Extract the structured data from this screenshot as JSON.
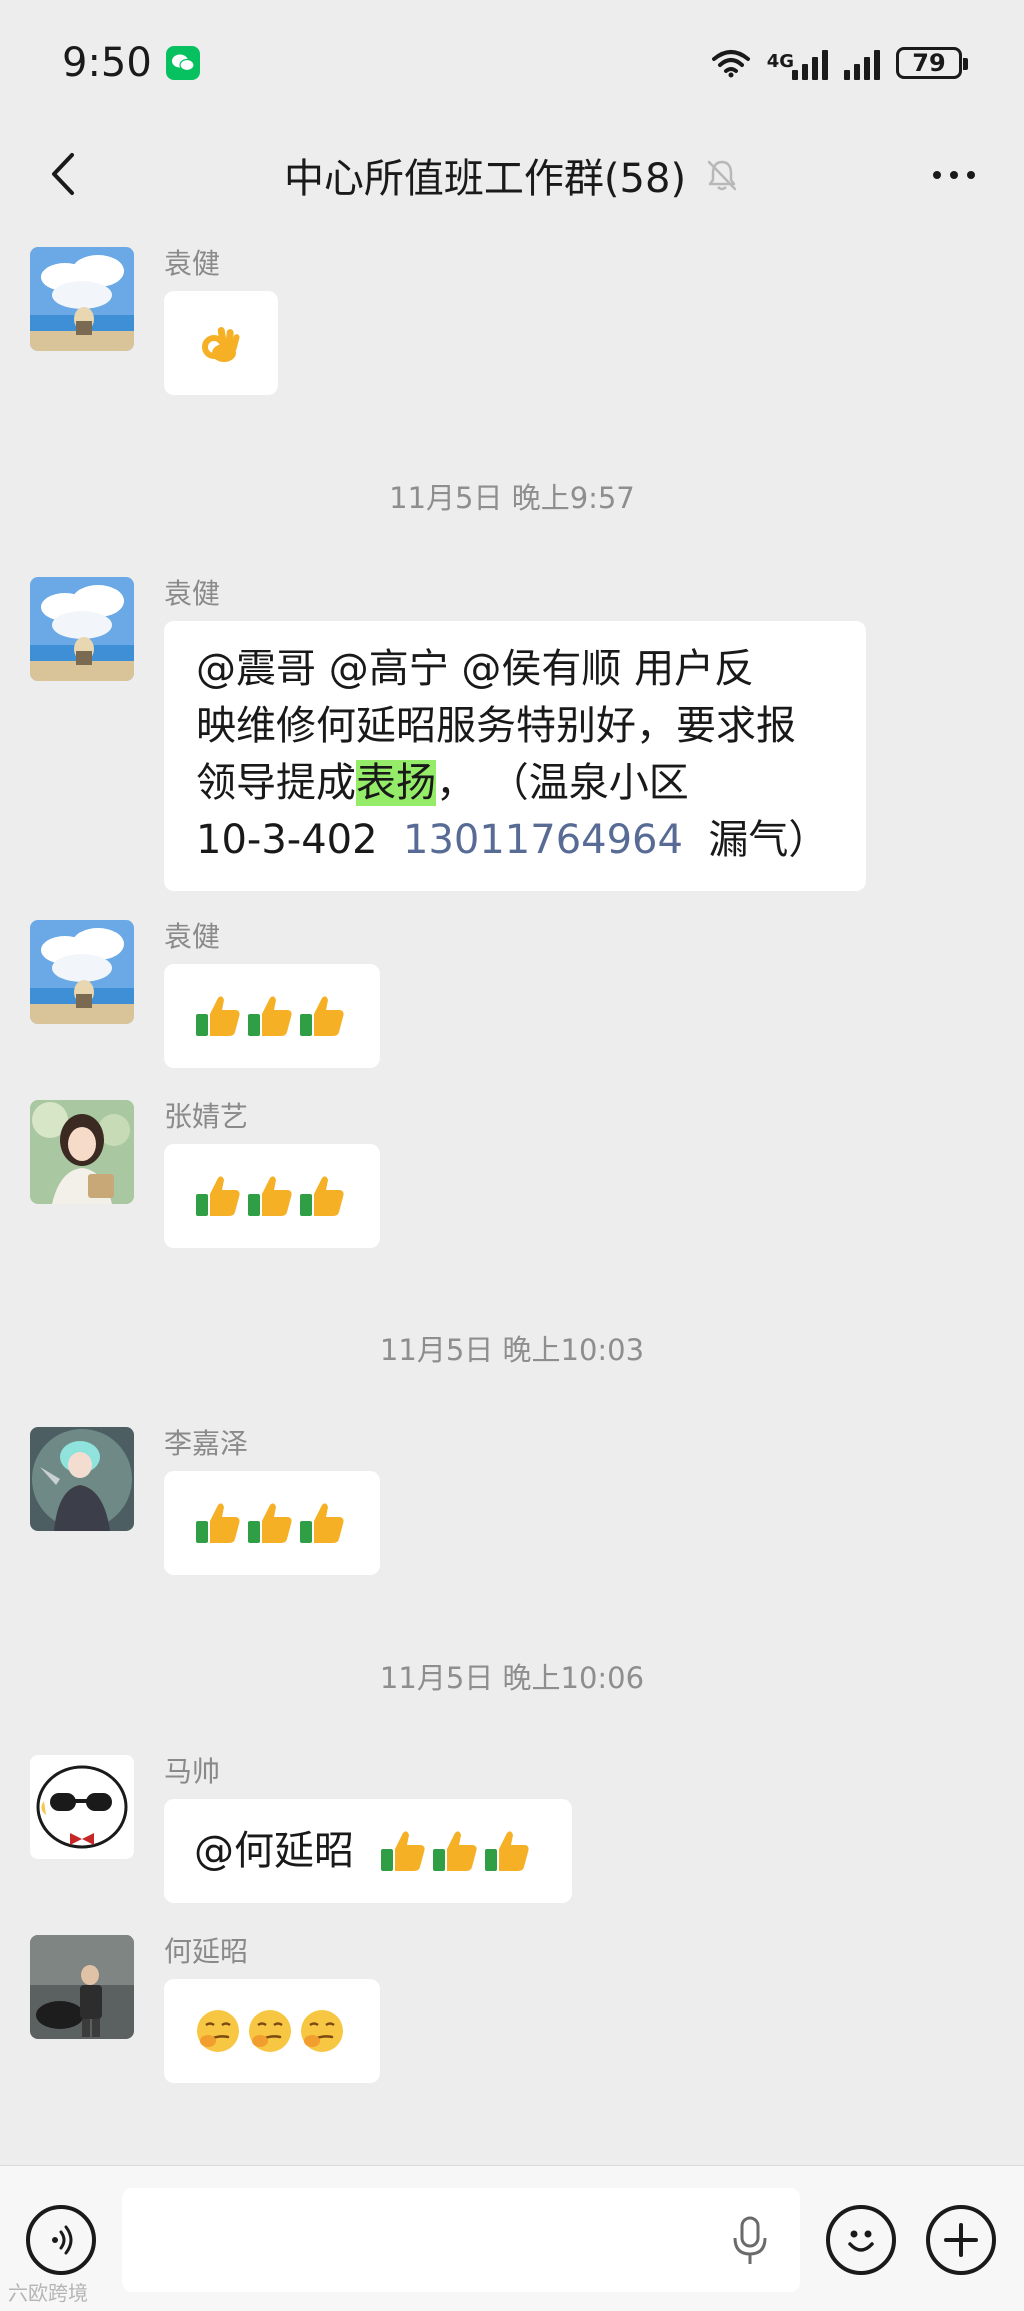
{
  "status_bar": {
    "time": "9:50",
    "network": "4G",
    "battery": "79"
  },
  "header": {
    "title": "中心所值班工作群(58)"
  },
  "messages": [
    {
      "type": "message",
      "sender": "袁健",
      "content": "ok-hand-emoji"
    },
    {
      "type": "timestamp",
      "text": "11月5日 晚上9:57"
    },
    {
      "type": "message",
      "sender": "袁健",
      "lines": [
        "@震哥  @高宁  @侯有顺   用户反",
        "映维修何延昭服务特别好，要求报",
        "领导提成",
        "表扬",
        "，  （温泉小区",
        "10-3-402  ",
        "13011764964",
        "  漏气）"
      ]
    },
    {
      "type": "message",
      "sender": "袁健",
      "content": "thumbs-up-emoji x3"
    },
    {
      "type": "message",
      "sender": "张婧艺",
      "content": "thumbs-up-emoji x3"
    },
    {
      "type": "timestamp",
      "text": "11月5日 晚上10:03"
    },
    {
      "type": "message",
      "sender": "李嘉泽",
      "content": "thumbs-up-emoji x3"
    },
    {
      "type": "timestamp",
      "text": "11月5日 晚上10:06"
    },
    {
      "type": "message",
      "sender": "马帅",
      "text": "@何延昭 ",
      "content": "thumbs-up-emoji x3"
    },
    {
      "type": "message",
      "sender": "何延昭",
      "content": "smirk-emoji x3"
    }
  ],
  "icons": {
    "back": "chevron-left-icon",
    "mute": "bell-off-icon",
    "more": "more-dots-icon",
    "voice": "voice-icon",
    "mic": "microphone-icon",
    "emoji": "smiley-icon",
    "plus": "plus-icon"
  },
  "colors": {
    "background": "#ededed",
    "bubble": "#ffffff",
    "highlight": "#95ec69",
    "phone_link": "#576b95",
    "wechat_green": "#07c160"
  },
  "watermark": "六欧跨境"
}
